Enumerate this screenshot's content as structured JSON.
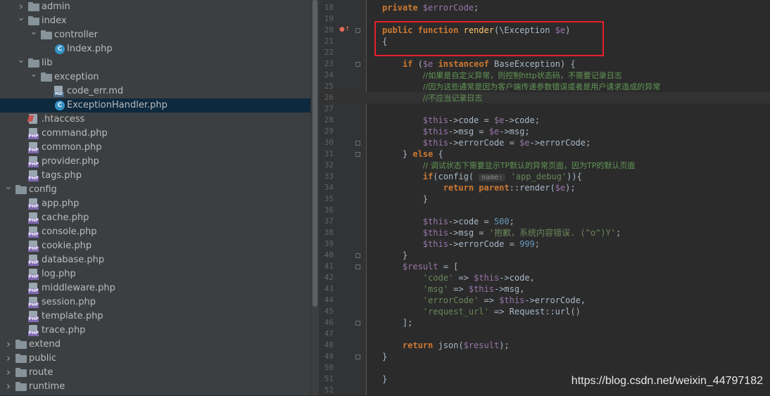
{
  "tree": {
    "items": [
      {
        "label": "admin",
        "type": "folder",
        "expanded": false,
        "depth": 1
      },
      {
        "label": "index",
        "type": "folder",
        "expanded": true,
        "depth": 1
      },
      {
        "label": "controller",
        "type": "folder",
        "expanded": true,
        "depth": 2
      },
      {
        "label": "Index.php",
        "type": "class",
        "depth": 3
      },
      {
        "label": "lib",
        "type": "folder",
        "expanded": true,
        "depth": 1
      },
      {
        "label": "exception",
        "type": "folder",
        "expanded": true,
        "depth": 2
      },
      {
        "label": "code_err.md",
        "type": "md",
        "depth": 3
      },
      {
        "label": "ExceptionHandler.php",
        "type": "class",
        "depth": 3,
        "selected": true
      },
      {
        "label": ".htaccess",
        "type": "htaccess",
        "depth": 1
      },
      {
        "label": "command.php",
        "type": "php",
        "depth": 1
      },
      {
        "label": "common.php",
        "type": "php",
        "depth": 1
      },
      {
        "label": "provider.php",
        "type": "php",
        "depth": 1
      },
      {
        "label": "tags.php",
        "type": "php",
        "depth": 1
      },
      {
        "label": "config",
        "type": "folder",
        "expanded": true,
        "depth": 0
      },
      {
        "label": "app.php",
        "type": "php",
        "depth": 1
      },
      {
        "label": "cache.php",
        "type": "php",
        "depth": 1
      },
      {
        "label": "console.php",
        "type": "php",
        "depth": 1
      },
      {
        "label": "cookie.php",
        "type": "php",
        "depth": 1
      },
      {
        "label": "database.php",
        "type": "php",
        "depth": 1
      },
      {
        "label": "log.php",
        "type": "php",
        "depth": 1
      },
      {
        "label": "middleware.php",
        "type": "php",
        "depth": 1
      },
      {
        "label": "session.php",
        "type": "php",
        "depth": 1
      },
      {
        "label": "template.php",
        "type": "php",
        "depth": 1
      },
      {
        "label": "trace.php",
        "type": "php",
        "depth": 1
      },
      {
        "label": "extend",
        "type": "folder",
        "expanded": false,
        "depth": 0
      },
      {
        "label": "public",
        "type": "folder",
        "expanded": false,
        "depth": 0
      },
      {
        "label": "route",
        "type": "folder",
        "expanded": false,
        "depth": 0
      },
      {
        "label": "runtime",
        "type": "folder",
        "expanded": false,
        "depth": 0
      }
    ]
  },
  "icons": {
    "folder": "folder-icon",
    "class": "php-class-icon",
    "php": "php-file-icon",
    "md": "markdown-file-icon",
    "htaccess": "htaccess-file-icon"
  },
  "colors": {
    "keyword": "#cc7832",
    "variable": "#9876aa",
    "function": "#ffc66d",
    "string": "#6a8759",
    "number": "#6897bb",
    "comment": "#629755",
    "highlight_box": "#e8202a"
  },
  "editor": {
    "lines": [
      {
        "n": "18",
        "tokens": [
          [
            "kw",
            "private "
          ],
          [
            "var",
            "$errorCode"
          ],
          [
            "",
            "; "
          ]
        ]
      },
      {
        "n": "19",
        "tokens": []
      },
      {
        "n": "20",
        "tokens": [
          [
            "kw",
            "public function "
          ],
          [
            "fn",
            "render"
          ],
          [
            "",
            "("
          ],
          [
            "",
            "\\"
          ],
          [
            "cls",
            "Exception "
          ],
          [
            "var",
            "$e"
          ],
          [
            "",
            ")"
          ]
        ]
      },
      {
        "n": "21",
        "tokens": [
          [
            "",
            "{"
          ]
        ]
      },
      {
        "n": "22",
        "tokens": []
      },
      {
        "n": "23",
        "tokens": [
          [
            "",
            "    "
          ],
          [
            "kw",
            "if "
          ],
          [
            "",
            "("
          ],
          [
            "var",
            "$e "
          ],
          [
            "kw",
            "instanceof "
          ],
          [
            "cls",
            "BaseException"
          ],
          [
            "",
            ") {"
          ]
        ]
      },
      {
        "n": "24",
        "tokens": [
          [
            "",
            "        "
          ],
          [
            "cmt",
            "//如果是自定义异常，则控制http状态码，不需要记录日志"
          ]
        ]
      },
      {
        "n": "25",
        "tokens": [
          [
            "",
            "        "
          ],
          [
            "cmt",
            "//因为这些通常是因为客户端传递参数错误或者是用户请求造成的异常"
          ]
        ]
      },
      {
        "n": "26",
        "tokens": [
          [
            "",
            "        "
          ],
          [
            "cmt",
            "//不应当记录日志"
          ]
        ]
      },
      {
        "n": "27",
        "tokens": []
      },
      {
        "n": "28",
        "tokens": [
          [
            "",
            "        "
          ],
          [
            "var",
            "$this"
          ],
          [
            "",
            "->"
          ],
          [
            "",
            "code = "
          ],
          [
            "var",
            "$e"
          ],
          [
            "",
            "->"
          ],
          [
            "",
            "code;"
          ]
        ]
      },
      {
        "n": "29",
        "tokens": [
          [
            "",
            "        "
          ],
          [
            "var",
            "$this"
          ],
          [
            "",
            "->"
          ],
          [
            "",
            "msg = "
          ],
          [
            "var",
            "$e"
          ],
          [
            "",
            "->"
          ],
          [
            "",
            "msg;"
          ]
        ]
      },
      {
        "n": "30",
        "tokens": [
          [
            "",
            "        "
          ],
          [
            "var",
            "$this"
          ],
          [
            "",
            "->"
          ],
          [
            "",
            "errorCode = "
          ],
          [
            "var",
            "$e"
          ],
          [
            "",
            "->"
          ],
          [
            "",
            "errorCode;"
          ]
        ]
      },
      {
        "n": "31",
        "tokens": [
          [
            "",
            "    } "
          ],
          [
            "kw",
            "else "
          ],
          [
            "",
            "{"
          ]
        ]
      },
      {
        "n": "32",
        "tokens": [
          [
            "",
            "        "
          ],
          [
            "cmt",
            "// 调试状态下需要显示TP默认的异常页面，因为TP的默认页面"
          ]
        ]
      },
      {
        "n": "33",
        "tokens": [
          [
            "",
            "        "
          ],
          [
            "kw",
            "if"
          ],
          [
            "",
            "("
          ],
          [
            "",
            "config( "
          ],
          [
            "hint",
            "name:"
          ],
          [
            "",
            " "
          ],
          [
            "str",
            "'app_debug'"
          ],
          [
            "",
            "))"
          ],
          [
            "",
            "{"
          ]
        ]
      },
      {
        "n": "34",
        "tokens": [
          [
            "",
            "            "
          ],
          [
            "kw",
            "return "
          ],
          [
            "kw",
            "parent"
          ],
          [
            "",
            "::"
          ],
          [
            "",
            "render("
          ],
          [
            "var",
            "$e"
          ],
          [
            "",
            ");"
          ]
        ]
      },
      {
        "n": "35",
        "tokens": [
          [
            "",
            "        }"
          ]
        ]
      },
      {
        "n": "36",
        "tokens": []
      },
      {
        "n": "37",
        "tokens": [
          [
            "",
            "        "
          ],
          [
            "var",
            "$this"
          ],
          [
            "",
            "->"
          ],
          [
            "",
            "code = "
          ],
          [
            "num",
            "500"
          ],
          [
            "",
            ";"
          ]
        ]
      },
      {
        "n": "38",
        "tokens": [
          [
            "",
            "        "
          ],
          [
            "var",
            "$this"
          ],
          [
            "",
            "->"
          ],
          [
            "",
            "msg = "
          ],
          [
            "str",
            "'抱歉，系统内容错误. (^o^)Y'"
          ],
          [
            "",
            ";"
          ]
        ]
      },
      {
        "n": "39",
        "tokens": [
          [
            "",
            "        "
          ],
          [
            "var",
            "$this"
          ],
          [
            "",
            "->"
          ],
          [
            "",
            "errorCode = "
          ],
          [
            "num",
            "999"
          ],
          [
            "",
            ";"
          ]
        ]
      },
      {
        "n": "40",
        "tokens": [
          [
            "",
            "    }"
          ]
        ]
      },
      {
        "n": "41",
        "tokens": [
          [
            "",
            "    "
          ],
          [
            "var",
            "$result "
          ],
          [
            "",
            "= ["
          ]
        ]
      },
      {
        "n": "42",
        "tokens": [
          [
            "",
            "        "
          ],
          [
            "str",
            "'code' "
          ],
          [
            "",
            "=> "
          ],
          [
            "var",
            "$this"
          ],
          [
            "",
            "->"
          ],
          [
            "",
            "code,"
          ]
        ]
      },
      {
        "n": "43",
        "tokens": [
          [
            "",
            "        "
          ],
          [
            "str",
            "'msg' "
          ],
          [
            "",
            "=> "
          ],
          [
            "var",
            "$this"
          ],
          [
            "",
            "->"
          ],
          [
            "",
            "msg,"
          ]
        ]
      },
      {
        "n": "44",
        "tokens": [
          [
            "",
            "        "
          ],
          [
            "str",
            "'errorCode' "
          ],
          [
            "",
            "=> "
          ],
          [
            "var",
            "$this"
          ],
          [
            "",
            "->"
          ],
          [
            "",
            "errorCode,"
          ]
        ]
      },
      {
        "n": "45",
        "tokens": [
          [
            "",
            "        "
          ],
          [
            "str",
            "'request_url' "
          ],
          [
            "",
            "=> "
          ],
          [
            "",
            "Request"
          ],
          [
            "",
            "::"
          ],
          [
            "",
            "url()"
          ]
        ]
      },
      {
        "n": "46",
        "tokens": [
          [
            "",
            "    ];"
          ]
        ]
      },
      {
        "n": "47",
        "tokens": []
      },
      {
        "n": "48",
        "tokens": [
          [
            "",
            "    "
          ],
          [
            "kw",
            "return "
          ],
          [
            "",
            "json("
          ],
          [
            "var",
            "$result"
          ],
          [
            "",
            ");"
          ]
        ]
      },
      {
        "n": "49",
        "tokens": [
          [
            "",
            "}"
          ]
        ]
      },
      {
        "n": "50",
        "tokens": []
      },
      {
        "n": "51",
        "tokens": [
          [
            "",
            "}"
          ]
        ]
      },
      {
        "n": "52",
        "tokens": []
      }
    ]
  },
  "watermark": "https://blog.csdn.net/weixin_44797182"
}
